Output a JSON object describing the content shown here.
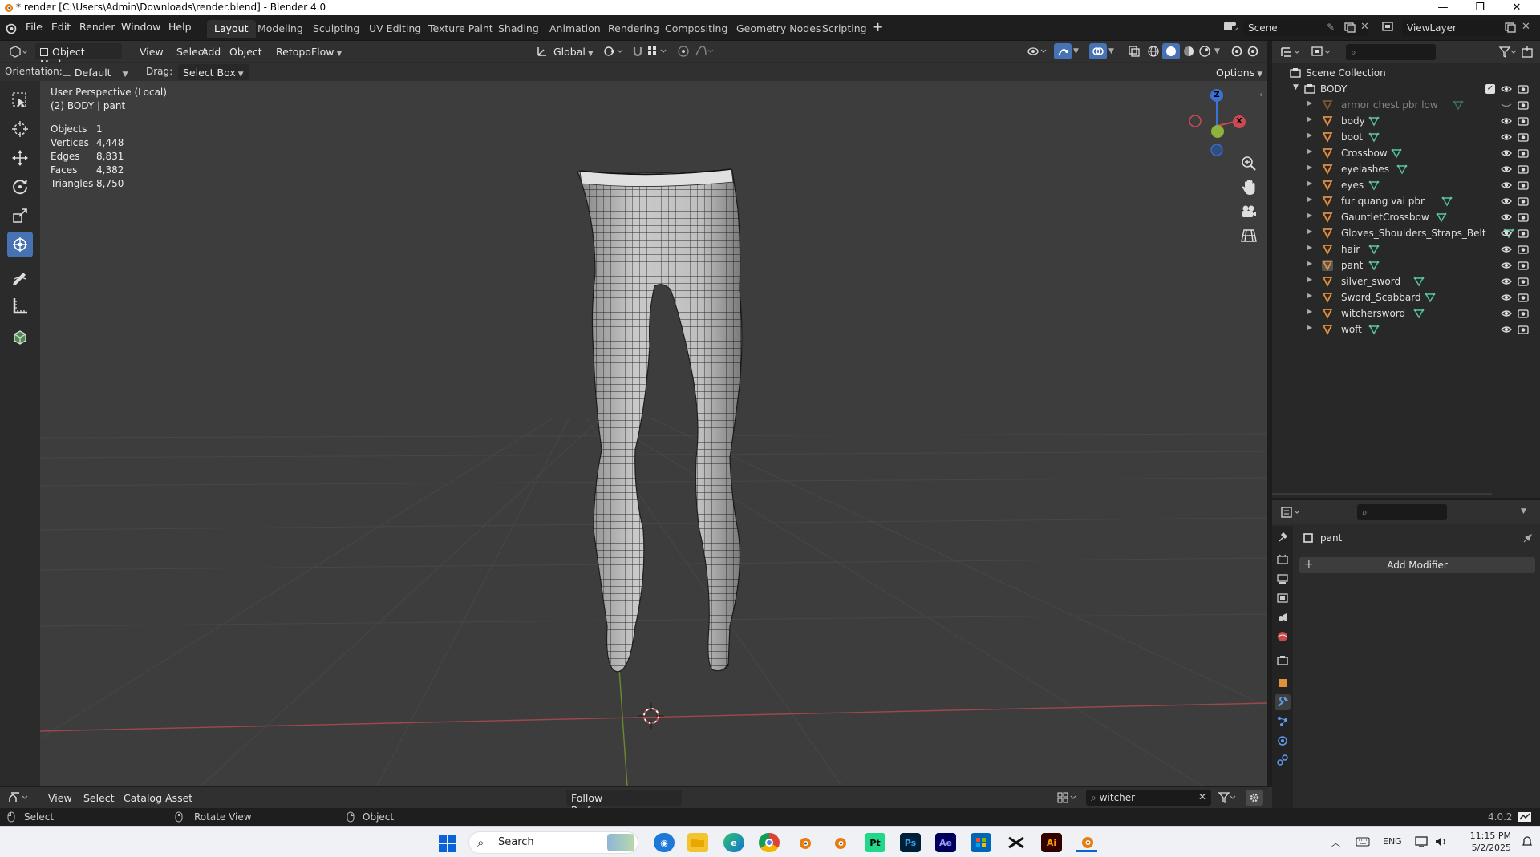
{
  "window": {
    "title": "* render [C:\\Users\\Admin\\Downloads\\render.blend] - Blender 4.0"
  },
  "menu": [
    "File",
    "Edit",
    "Render",
    "Window",
    "Help"
  ],
  "workspaces": [
    "Layout",
    "Modeling",
    "Sculpting",
    "UV Editing",
    "Texture Paint",
    "Shading",
    "Animation",
    "Rendering",
    "Compositing",
    "Geometry Nodes",
    "Scripting"
  ],
  "active_workspace": "Layout",
  "scene": {
    "name": "Scene",
    "view_layer": "ViewLayer"
  },
  "viewport_header": {
    "mode": "Object Mode",
    "menus": [
      "View",
      "Select",
      "Add",
      "Object"
    ],
    "addon": "RetopoFlow",
    "transform": "Global",
    "orientation_label": "Orientation:",
    "orientation_value": "Default",
    "drag_label": "Drag:",
    "drag_value": "Select Box",
    "options": "Options"
  },
  "viewport": {
    "view_name": "User Perspective (Local)",
    "object_info": "(2) BODY | pant",
    "stats": [
      {
        "label": "Objects",
        "value": "1"
      },
      {
        "label": "Vertices",
        "value": "4,448"
      },
      {
        "label": "Edges",
        "value": "8,831"
      },
      {
        "label": "Faces",
        "value": "4,382"
      },
      {
        "label": "Triangles",
        "value": "8,750"
      }
    ],
    "gizmo": {
      "x": "X",
      "y": "Y",
      "z": "Z"
    }
  },
  "outliner": {
    "root": "Scene Collection",
    "collection": "BODY",
    "items": [
      {
        "name": "armor chest pbr low",
        "dimmed": true
      },
      {
        "name": "body",
        "dimmed": false
      },
      {
        "name": "boot",
        "dimmed": false
      },
      {
        "name": "Crossbow",
        "dimmed": false
      },
      {
        "name": "eyelashes",
        "dimmed": false
      },
      {
        "name": "eyes",
        "dimmed": false
      },
      {
        "name": "fur quang vai pbr",
        "dimmed": false
      },
      {
        "name": "GauntletCrossbow",
        "dimmed": false
      },
      {
        "name": "Gloves_Shoulders_Straps_Belt",
        "dimmed": false
      },
      {
        "name": "hair",
        "dimmed": false
      },
      {
        "name": "pant",
        "dimmed": false,
        "active": true
      },
      {
        "name": "silver_sword",
        "dimmed": false
      },
      {
        "name": "Sword_Scabbard",
        "dimmed": false
      },
      {
        "name": "witchersword",
        "dimmed": false
      },
      {
        "name": "woft",
        "dimmed": false
      }
    ]
  },
  "properties": {
    "object_name": "pant",
    "add_modifier": "Add Modifier"
  },
  "asset_bar": {
    "menus": [
      "View",
      "Select",
      "Catalog",
      "Asset"
    ],
    "import_method": "Follow Preferences",
    "search_value": "witcher"
  },
  "statusbar": {
    "select": "Select",
    "rotate": "Rotate View",
    "object": "Object",
    "version": "4.0.2"
  },
  "taskbar": {
    "search_placeholder": "Search",
    "lang": "ENG",
    "time": "11:15 PM",
    "date": "5/2/2025",
    "apps": [
      {
        "label": "Pt",
        "color": "#21d789"
      },
      {
        "label": "Ps",
        "color": "#001e36"
      },
      {
        "label": "Ae",
        "color": "#00005b"
      },
      {
        "label": "Ai",
        "color": "#330000"
      }
    ]
  },
  "colors": {
    "accent": "#4772b3",
    "x_axis": "#c94a52",
    "y_axis": "#8cb43c",
    "z_axis": "#3a72d8",
    "mesh_icon": "#e3903b",
    "mesh_data": "#58c4a2"
  }
}
